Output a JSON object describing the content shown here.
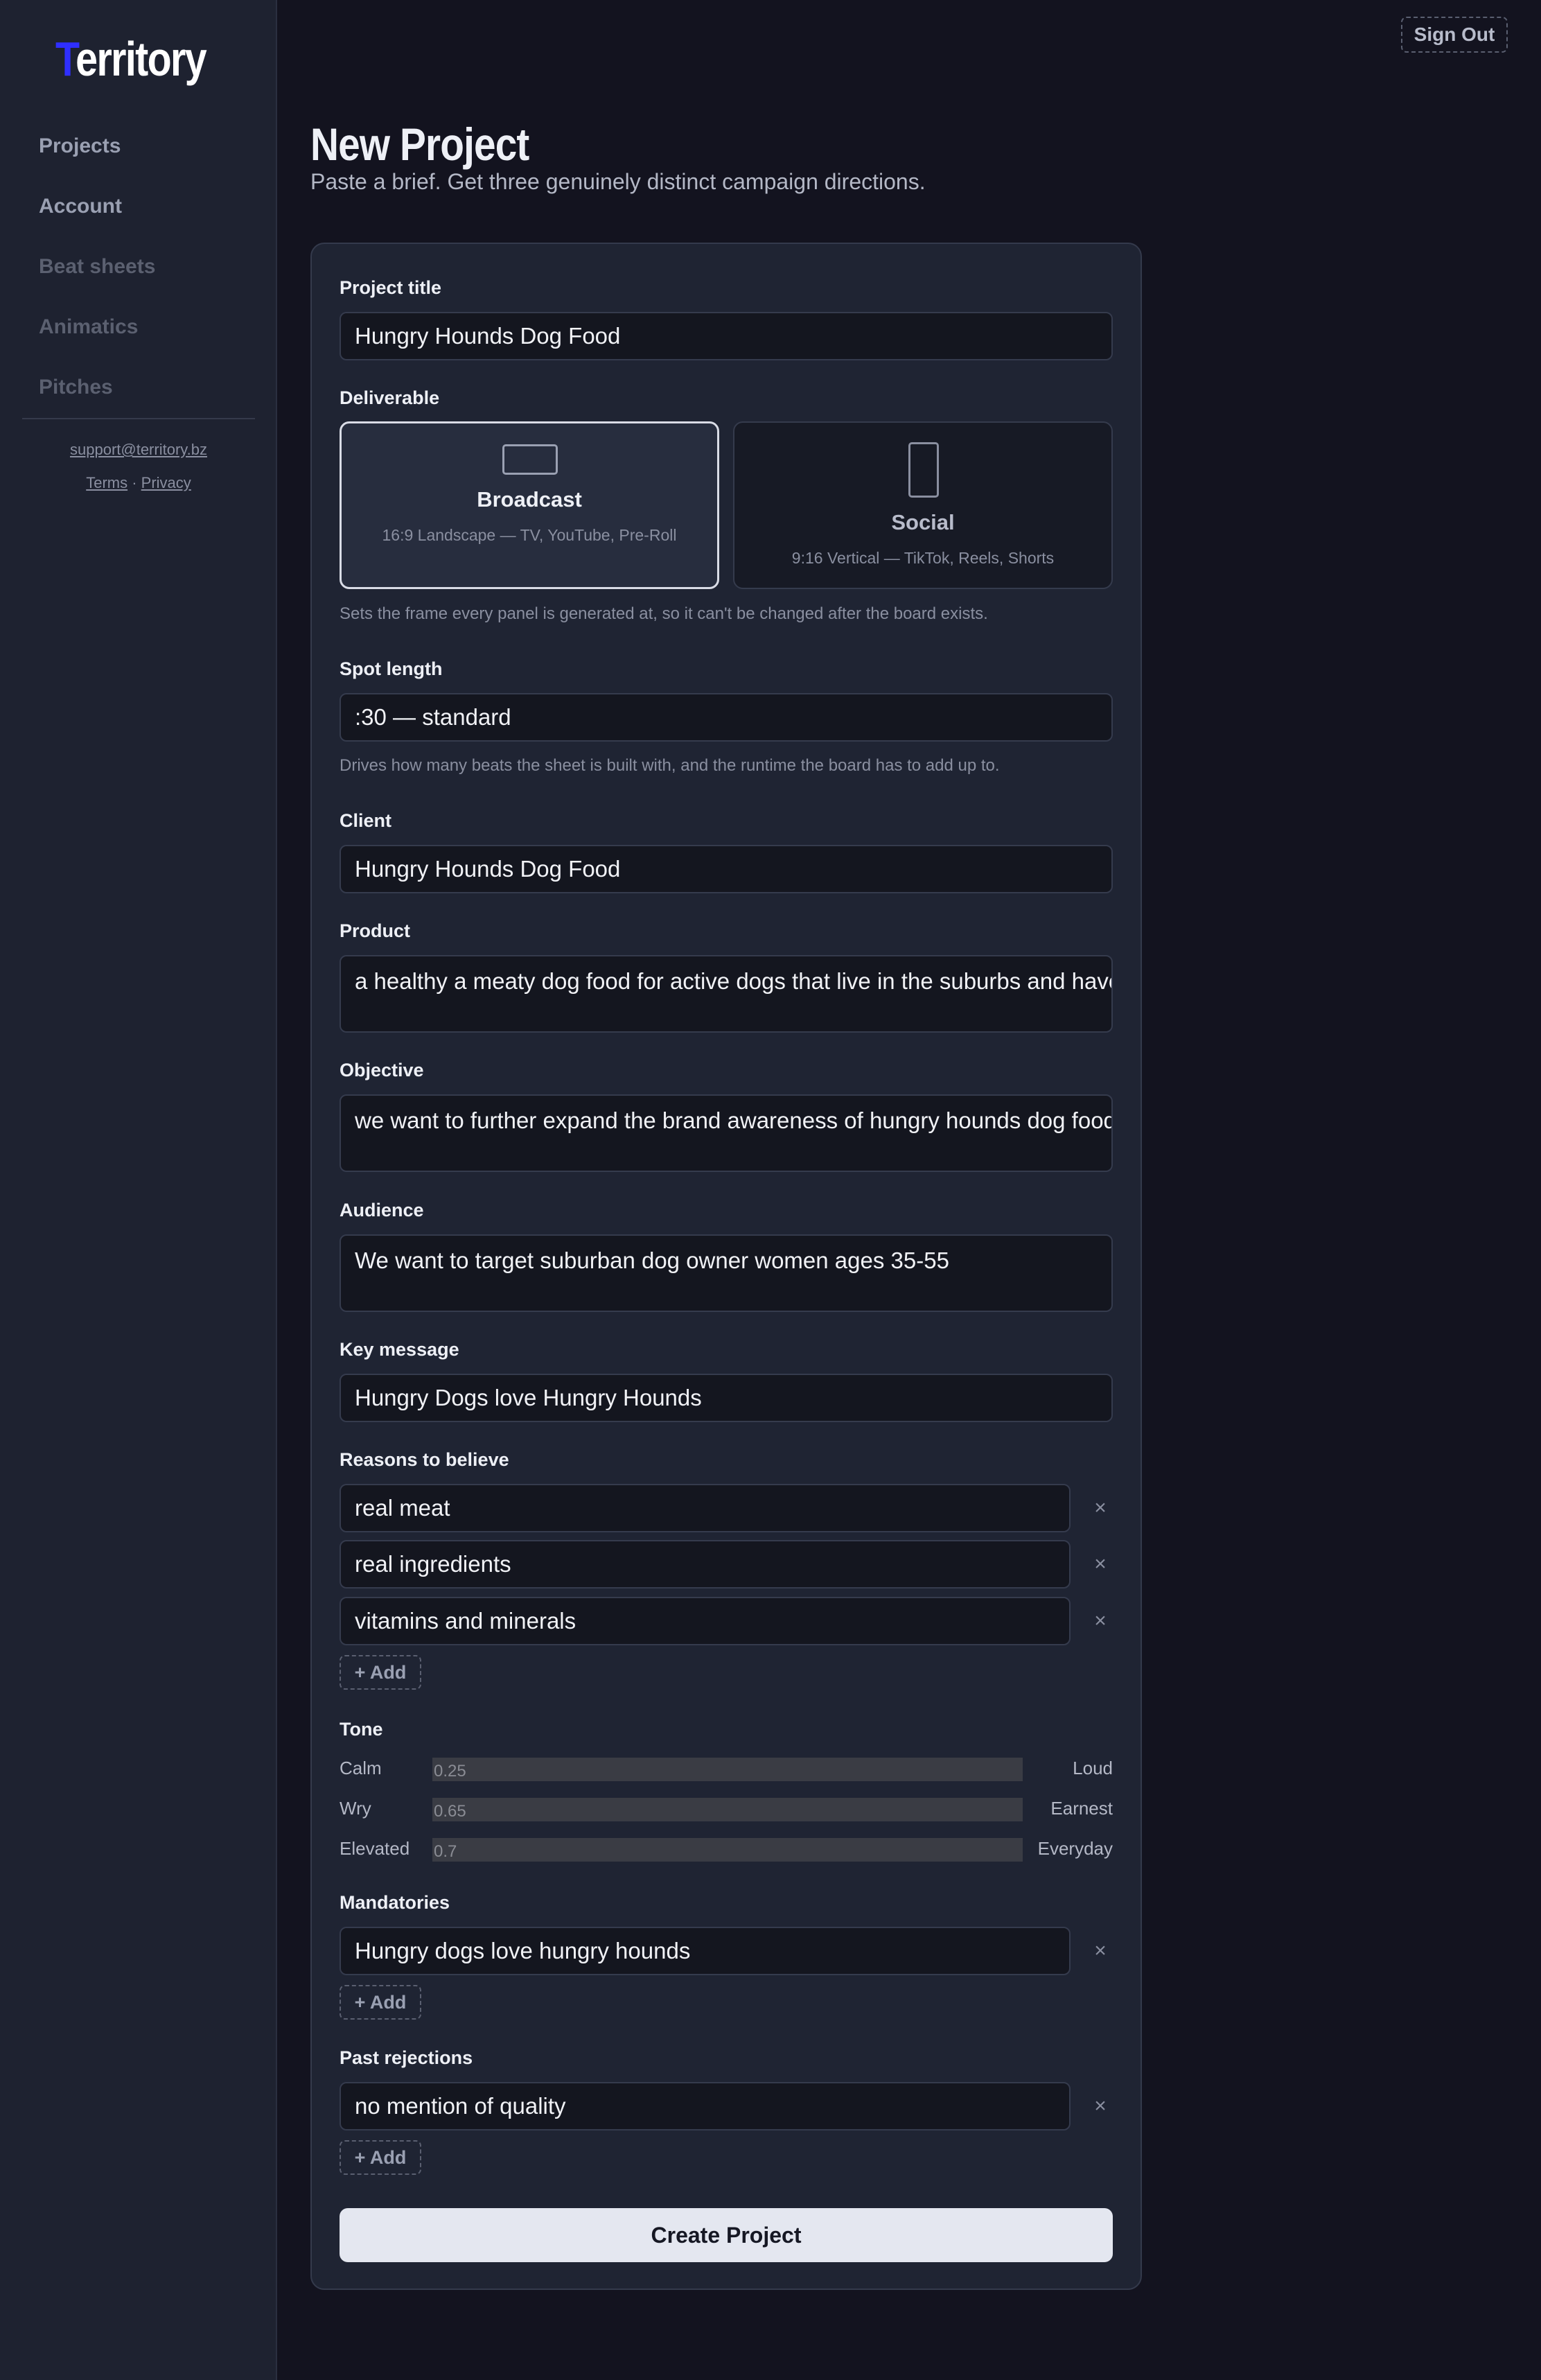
{
  "brand": {
    "logo_first": "T",
    "logo_rest": "erritory"
  },
  "sidebar": {
    "items": [
      {
        "label": "Projects"
      },
      {
        "label": "Account"
      },
      {
        "label": "Beat sheets"
      },
      {
        "label": "Animatics"
      },
      {
        "label": "Pitches"
      }
    ],
    "support_email": "support@territory.bz",
    "terms": "Terms",
    "separator": "·",
    "privacy": "Privacy"
  },
  "header": {
    "sign_out": "Sign Out",
    "title": "New Project",
    "subtitle": "Paste a brief. Get three genuinely distinct campaign directions."
  },
  "form": {
    "project_title": {
      "label": "Project title",
      "value": "Hungry Hounds Dog Food"
    },
    "deliverable": {
      "label": "Deliverable",
      "options": [
        {
          "title": "Broadcast",
          "desc": "16:9 Landscape — TV, YouTube, Pre-Roll",
          "selected": true,
          "icon": "landscape-frame-icon"
        },
        {
          "title": "Social",
          "desc": "9:16 Vertical — TikTok, Reels, Shorts",
          "selected": false,
          "icon": "portrait-frame-icon"
        }
      ],
      "help": "Sets the frame every panel is generated at, so it can't be changed after the board exists."
    },
    "spot_length": {
      "label": "Spot length",
      "value": ":30 — standard",
      "help": "Drives how many beats the sheet is built with, and the runtime the board has to add up to."
    },
    "client": {
      "label": "Client",
      "value": "Hungry Hounds Dog Food"
    },
    "product": {
      "label": "Product",
      "value": "a healthy a meaty dog food for active dogs that live in the suburbs and have"
    },
    "objective": {
      "label": "Objective",
      "value": "we want to further expand the brand awareness of hungry hounds dog food"
    },
    "audience": {
      "label": "Audience",
      "value": "We want to target suburban dog owner women ages 35-55"
    },
    "key_message": {
      "label": "Key message",
      "value": "Hungry Dogs love Hungry Hounds"
    },
    "reasons": {
      "label": "Reasons to believe",
      "items": [
        "real meat",
        "real ingredients",
        "vitamins and minerals"
      ],
      "add_label": "+ Add",
      "remove_glyph": "×"
    },
    "tone": {
      "label": "Tone",
      "sliders": [
        {
          "left": "Calm",
          "right": "Loud",
          "value": "0.25"
        },
        {
          "left": "Wry",
          "right": "Earnest",
          "value": "0.65"
        },
        {
          "left": "Elevated",
          "right": "Everyday",
          "value": "0.7"
        }
      ]
    },
    "mandatories": {
      "label": "Mandatories",
      "items": [
        "Hungry dogs love hungry hounds"
      ],
      "add_label": "+ Add"
    },
    "past_rejections": {
      "label": "Past rejections",
      "items": [
        "no mention of quality"
      ],
      "add_label": "+ Add"
    },
    "submit_label": "Create Project"
  },
  "colors": {
    "background": "#13131f",
    "sidebar": "#1e2230",
    "card": "#1f2433",
    "input": "#14161f",
    "logo_accent": "#2f2fff",
    "primary_button": "#e4e7f0"
  }
}
